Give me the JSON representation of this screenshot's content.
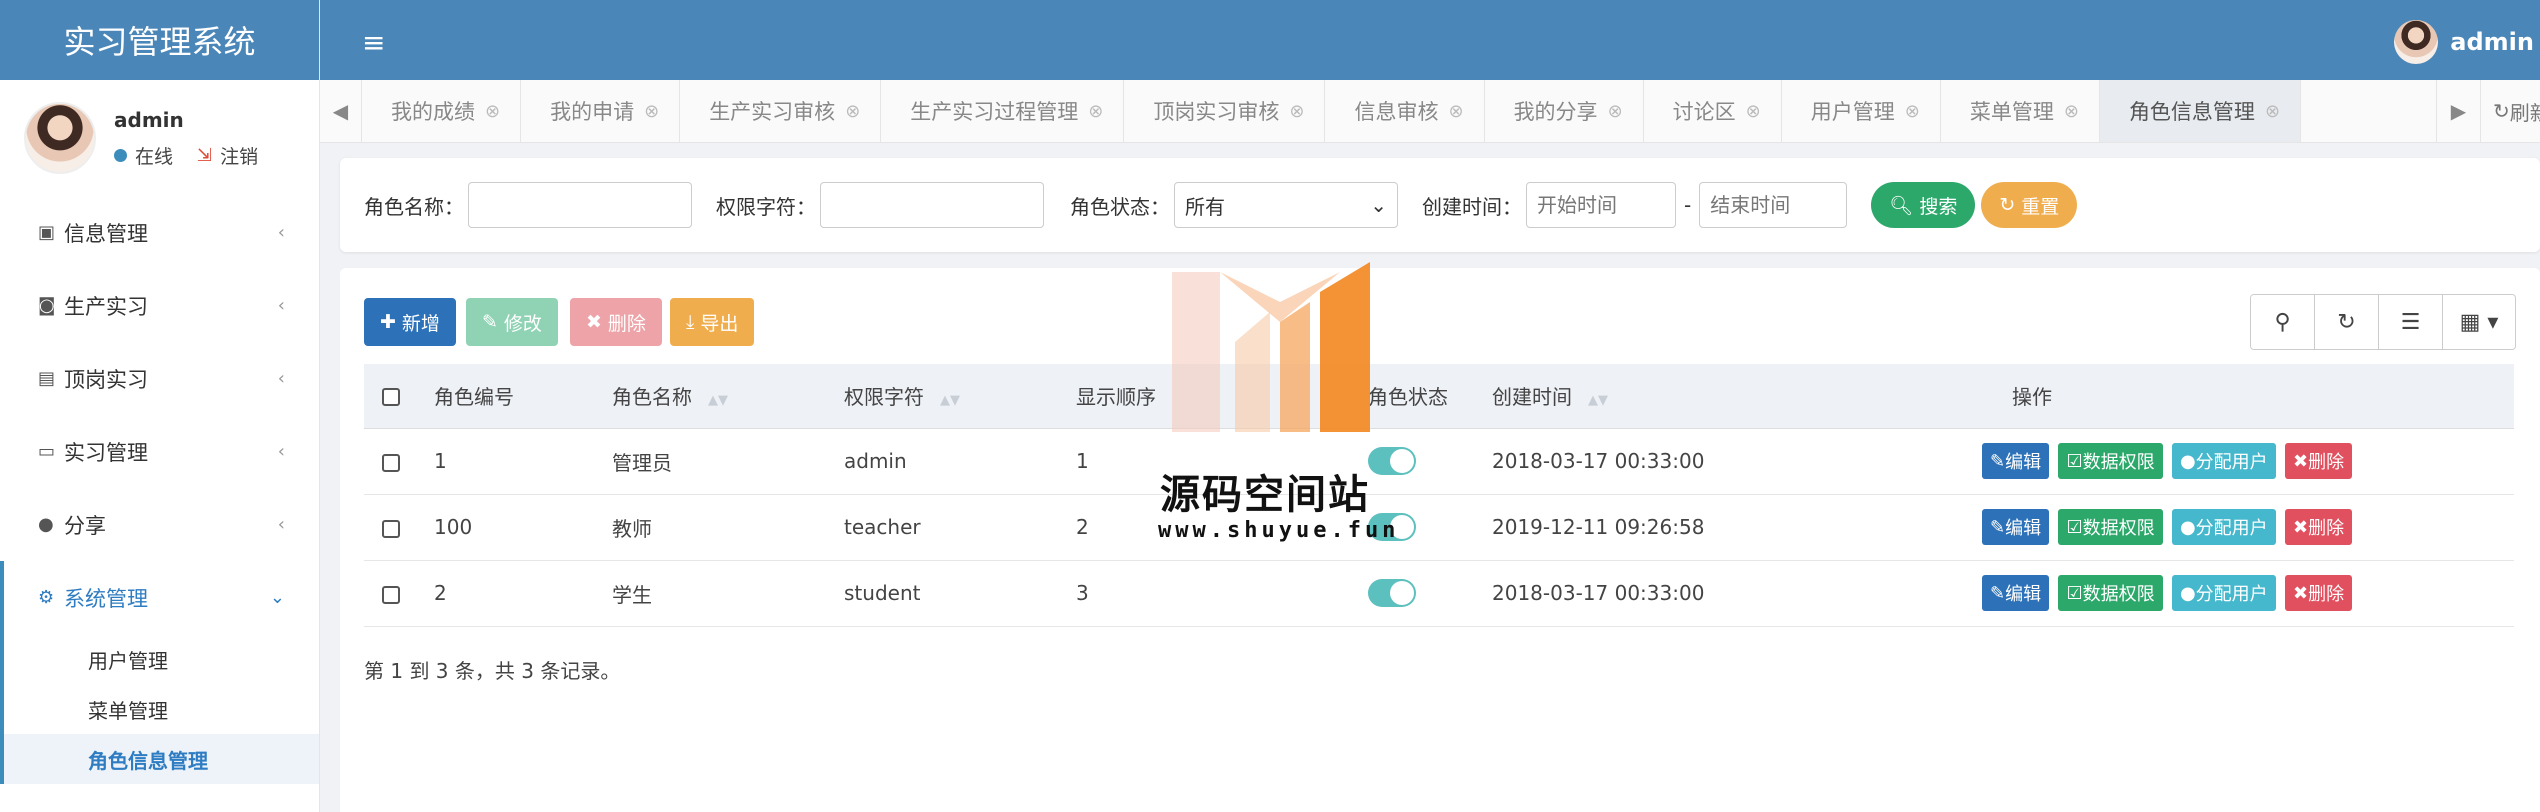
{
  "app": {
    "title": "实习管理系统"
  },
  "user": {
    "name": "admin",
    "status": "在线",
    "logout": "注销"
  },
  "sidebar": {
    "items": [
      {
        "label": "信息管理",
        "icon": "id-card-icon"
      },
      {
        "label": "生产实习",
        "icon": "user-icon"
      },
      {
        "label": "顶岗实习",
        "icon": "address-card-icon"
      },
      {
        "label": "实习管理",
        "icon": "contact-card-icon"
      },
      {
        "label": "分享",
        "icon": "comment-icon"
      },
      {
        "label": "系统管理",
        "icon": "gear-icon"
      }
    ],
    "submenu": [
      "用户管理",
      "菜单管理",
      "角色信息管理"
    ]
  },
  "header": {
    "user_name": "admin"
  },
  "tabs": [
    "我的成绩",
    "我的申请",
    "生产实习审核",
    "生产实习过程管理",
    "顶岗实习审核",
    "信息审核",
    "我的分享",
    "讨论区",
    "用户管理",
    "菜单管理",
    "角色信息管理"
  ],
  "tab_refresh": "刷新",
  "search": {
    "role_name_label": "角色名称：",
    "perm_label": "权限字符：",
    "status_label": "角色状态：",
    "status_value": "所有",
    "created_label": "创建时间：",
    "start_placeholder": "开始时间",
    "end_placeholder": "结束时间",
    "range_sep": "-",
    "search_btn": "搜索",
    "reset_btn": "重置"
  },
  "toolbar": {
    "add": "新增",
    "edit": "修改",
    "delete": "删除",
    "export": "导出"
  },
  "table": {
    "columns": [
      "角色编号",
      "角色名称",
      "权限字符",
      "显示顺序",
      "角色状态",
      "创建时间",
      "操作"
    ],
    "rows": [
      {
        "id": "1",
        "name": "管理员",
        "key": "admin",
        "order": "1",
        "status": true,
        "created": "2018-03-17 00:33:00"
      },
      {
        "id": "100",
        "name": "教师",
        "key": "teacher",
        "order": "2",
        "status": true,
        "created": "2019-12-11 09:26:58"
      },
      {
        "id": "2",
        "name": "学生",
        "key": "student",
        "order": "3",
        "status": true,
        "created": "2018-03-17 00:33:00"
      }
    ],
    "actions": {
      "edit": "编辑",
      "data_perm": "数据权限",
      "assign": "分配用户",
      "delete": "删除"
    }
  },
  "pagination": {
    "text": "第 1 到 3 条，共 3 条记录。"
  },
  "watermark": {
    "title": "源码空间站",
    "url": "www.shuyue.fun"
  },
  "colors": {
    "header": "#4a86b8",
    "primary": "#2d72b8",
    "success": "#2da86b",
    "info": "#45b8cd",
    "danger": "#e0505e",
    "warning": "#f0ad4e"
  }
}
